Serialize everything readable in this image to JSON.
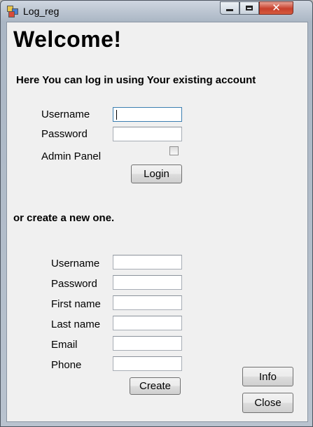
{
  "window": {
    "title": "Log_reg"
  },
  "header": {
    "welcome": "Welcome!",
    "subtitle": "Here You can log in using Your existing account"
  },
  "login": {
    "username_label": "Username",
    "username_value": "",
    "password_label": "Password",
    "password_value": "",
    "admin_label": "Admin Panel",
    "admin_checked": false,
    "login_button": "Login"
  },
  "register": {
    "prompt": "or create a new one.",
    "username_label": "Username",
    "password_label": "Password",
    "firstname_label": "First name",
    "lastname_label": "Last name",
    "email_label": "Email",
    "phone_label": "Phone",
    "create_button": "Create"
  },
  "actions": {
    "info_button": "Info",
    "close_button": "Close"
  },
  "colors": {
    "close_control": "#c7402c",
    "focus_border": "#3c7fb1",
    "form_bg": "#f0f0f0"
  }
}
